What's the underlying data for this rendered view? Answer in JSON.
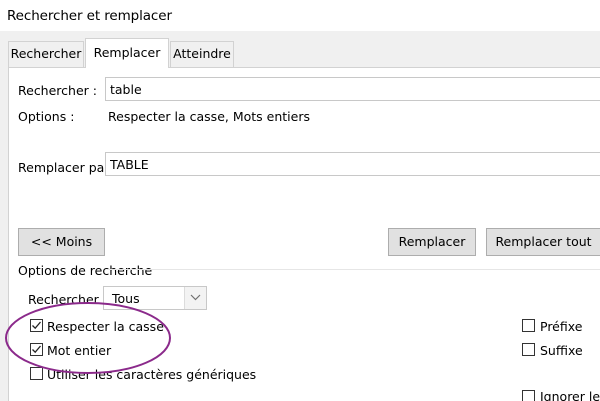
{
  "window": {
    "title": "Rechercher et remplacer"
  },
  "tabs": [
    {
      "label": "Rechercher"
    },
    {
      "label": "Remplacer",
      "active": true
    },
    {
      "label": "Atteindre"
    }
  ],
  "find": {
    "label": "Rechercher :",
    "value": "table"
  },
  "options_summary": {
    "label": "Options :",
    "value": "Respecter la casse, Mots entiers"
  },
  "replace": {
    "label": "Remplacer par :",
    "value": "TABLE"
  },
  "buttons": {
    "less": "<< Moins",
    "replace": "Remplacer",
    "replace_all": "Remplacer tout"
  },
  "search_options": {
    "heading": "Options de recherche",
    "search_label": "Rechercher :",
    "search_scope": "Tous",
    "checkboxes": [
      {
        "label": "Respecter la casse",
        "checked": true
      },
      {
        "label": "Mot entier",
        "checked": true
      },
      {
        "label": "Utiliser les caractères génériques",
        "checked": false
      },
      {
        "label": "Préfixe",
        "checked": false
      },
      {
        "label": "Suffixe",
        "checked": false
      },
      {
        "label": "Ignorer les p",
        "checked": false
      }
    ]
  },
  "colors": {
    "highlight_ellipse": "#8b2a8b",
    "panel": "#ffffff",
    "chrome": "#f0f0f0"
  }
}
